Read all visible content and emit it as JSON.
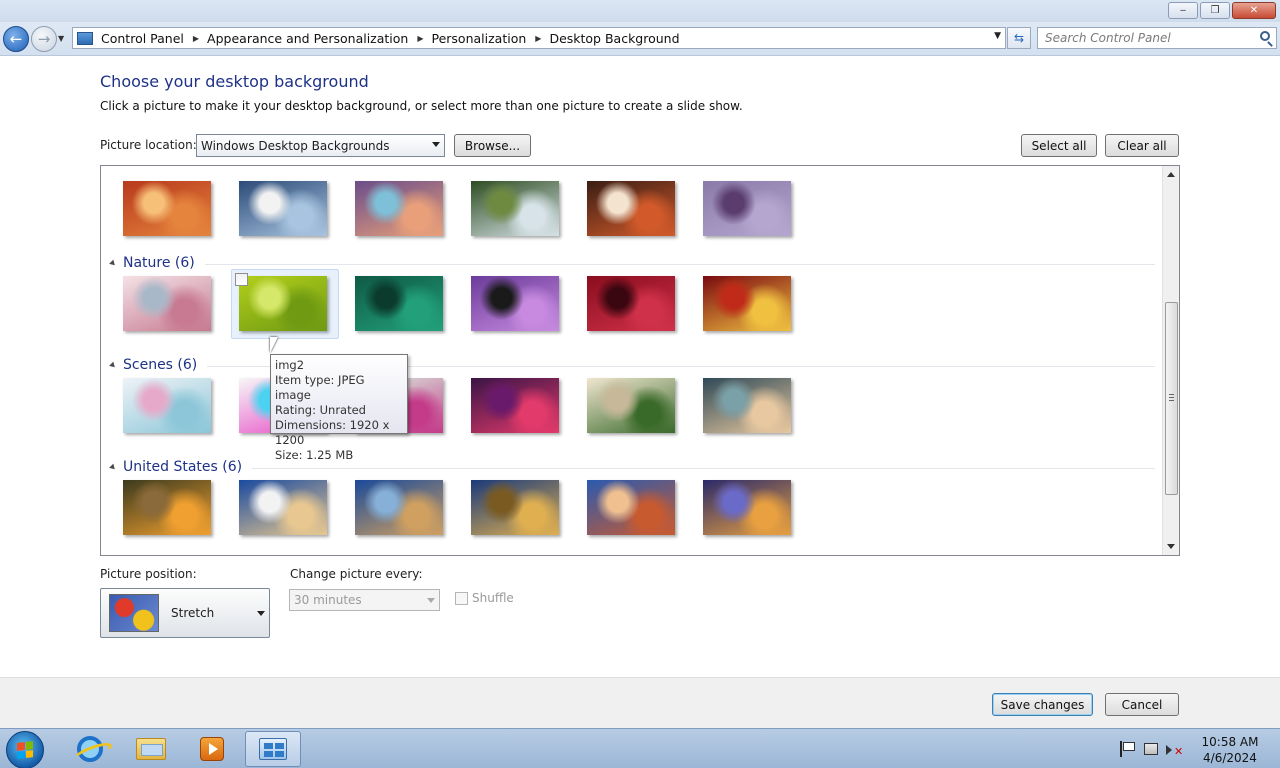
{
  "window": {
    "controls": {
      "minimize": "‒",
      "maximize": "❐",
      "close": "✕"
    }
  },
  "nav": {
    "back_icon": "back-arrow-icon",
    "forward_icon": "forward-arrow-icon",
    "breadcrumbs": [
      "Control Panel",
      "Appearance and Personalization",
      "Personalization",
      "Desktop Background"
    ],
    "search_placeholder": "Search Control Panel"
  },
  "content": {
    "title": "Choose your desktop background",
    "subtitle": "Click a picture to make it your desktop background, or select more than one picture to create a slide show.",
    "picture_location_label": "Picture location:",
    "picture_location_value": "Windows Desktop Backgrounds",
    "browse_label": "Browse...",
    "select_all_label": "Select all",
    "clear_all_label": "Clear all"
  },
  "groups": [
    {
      "title": "",
      "count": 6,
      "colors": [
        [
          "#b8391c",
          "#e5843d",
          "#f6c078"
        ],
        [
          "#2c4c78",
          "#a8c4e0",
          "#f2f2f2"
        ],
        [
          "#6a4d8a",
          "#e9a07a",
          "#7ec0d8"
        ],
        [
          "#2e4d22",
          "#d7e3e8",
          "#6e8a40"
        ],
        [
          "#3a1e15",
          "#d25a2a",
          "#f4e3cf"
        ],
        [
          "#8a7aa8",
          "#b5a6d0",
          "#5a3d6e"
        ]
      ]
    },
    {
      "title": "Nature (6)",
      "colors": [
        [
          "#f3e2e6",
          "#c77a91",
          "#a8b8c8"
        ],
        [
          "#b2cf1c",
          "#6f9a12",
          "#d6e86a"
        ],
        [
          "#0f5a45",
          "#22a07a",
          "#0b3b2c"
        ],
        [
          "#6b3c9a",
          "#c78ae0",
          "#1a1a1a"
        ],
        [
          "#8a0d1e",
          "#d0314a",
          "#3a0710"
        ],
        [
          "#7a0a10",
          "#f0c040",
          "#c02a18"
        ]
      ]
    },
    {
      "title": "Scenes (6)",
      "colors": [
        [
          "#eef3f7",
          "#8cc6d8",
          "#e6a9c9"
        ],
        [
          "#f7f7f7",
          "#e64ac5",
          "#4ad2f0"
        ],
        [
          "#d9f2e0",
          "#c43b8a",
          "#4d8c5a"
        ],
        [
          "#3a1446",
          "#e23a6a",
          "#6a1a6a"
        ],
        [
          "#f0e6d0",
          "#3a6a2a",
          "#c8b89a"
        ],
        [
          "#2f4a58",
          "#e8c8a0",
          "#7aa0a8"
        ]
      ]
    },
    {
      "title": "United States (6)",
      "colors": [
        [
          "#3c3a1e",
          "#f0a030",
          "#8a6a3a"
        ],
        [
          "#1a4aa0",
          "#e8c890",
          "#f2f2f2"
        ],
        [
          "#1a4a9a",
          "#d0a060",
          "#86b0d8"
        ],
        [
          "#1a3a7a",
          "#e0b050",
          "#7a5a20"
        ],
        [
          "#2a5ab0",
          "#c85a30",
          "#f0c090"
        ],
        [
          "#2a2a6a",
          "#e8a040",
          "#6a6ac8"
        ]
      ]
    }
  ],
  "selected": {
    "group": 1,
    "index": 1
  },
  "tooltip": {
    "name": "img2",
    "type": "Item type: JPEG image",
    "rating": "Rating: Unrated",
    "dimensions": "Dimensions: 1920 x 1200",
    "size": "Size: 1.25 MB"
  },
  "position": {
    "label": "Picture position:",
    "value": "Stretch"
  },
  "interval": {
    "label": "Change picture every:",
    "value": "30 minutes",
    "shuffle_label": "Shuffle",
    "disabled": true
  },
  "footer": {
    "save_label": "Save changes",
    "cancel_label": "Cancel"
  },
  "taskbar": {
    "items": [
      "internet-explorer-icon",
      "windows-explorer-icon",
      "media-player-icon",
      "control-panel-icon"
    ],
    "active_index": 3,
    "time": "10:58 AM",
    "date": "4/6/2024"
  }
}
